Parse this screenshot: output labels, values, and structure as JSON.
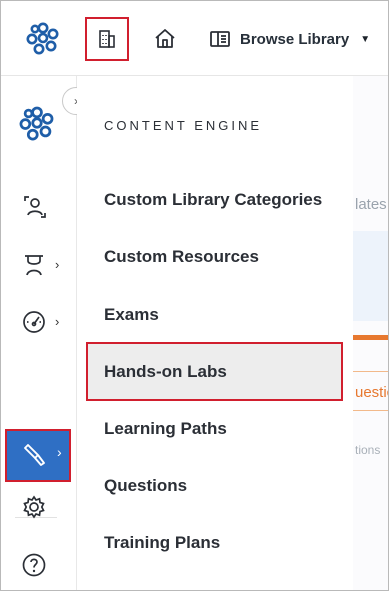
{
  "topbar": {
    "browse_label": "Browse Library",
    "icons": [
      "app-logo-icon",
      "building-icon",
      "home-icon",
      "library-icon",
      "caret-down-icon"
    ]
  },
  "rail": {
    "icons": [
      "app-logo-icon",
      "chevron-right-icon",
      "user-swap-icon",
      "instructor-icon",
      "gauge-icon",
      "brush-icon",
      "gear-icon",
      "help-icon"
    ]
  },
  "panel": {
    "title": "CONTENT ENGINE",
    "items": [
      {
        "label": "Custom Library Categories"
      },
      {
        "label": "Custom Resources"
      },
      {
        "label": "Exams"
      },
      {
        "label": "Hands-on Labs"
      },
      {
        "label": "Learning Paths"
      },
      {
        "label": "Questions"
      },
      {
        "label": "Training Plans"
      }
    ]
  },
  "background": {
    "text1": "lates",
    "text2": "uestic",
    "text3": "tions"
  },
  "colors": {
    "highlight_border": "#d11f2e",
    "active_rail": "#2f6fc4",
    "logo": "#1f5ea8",
    "accent_orange": "#e7782f"
  }
}
